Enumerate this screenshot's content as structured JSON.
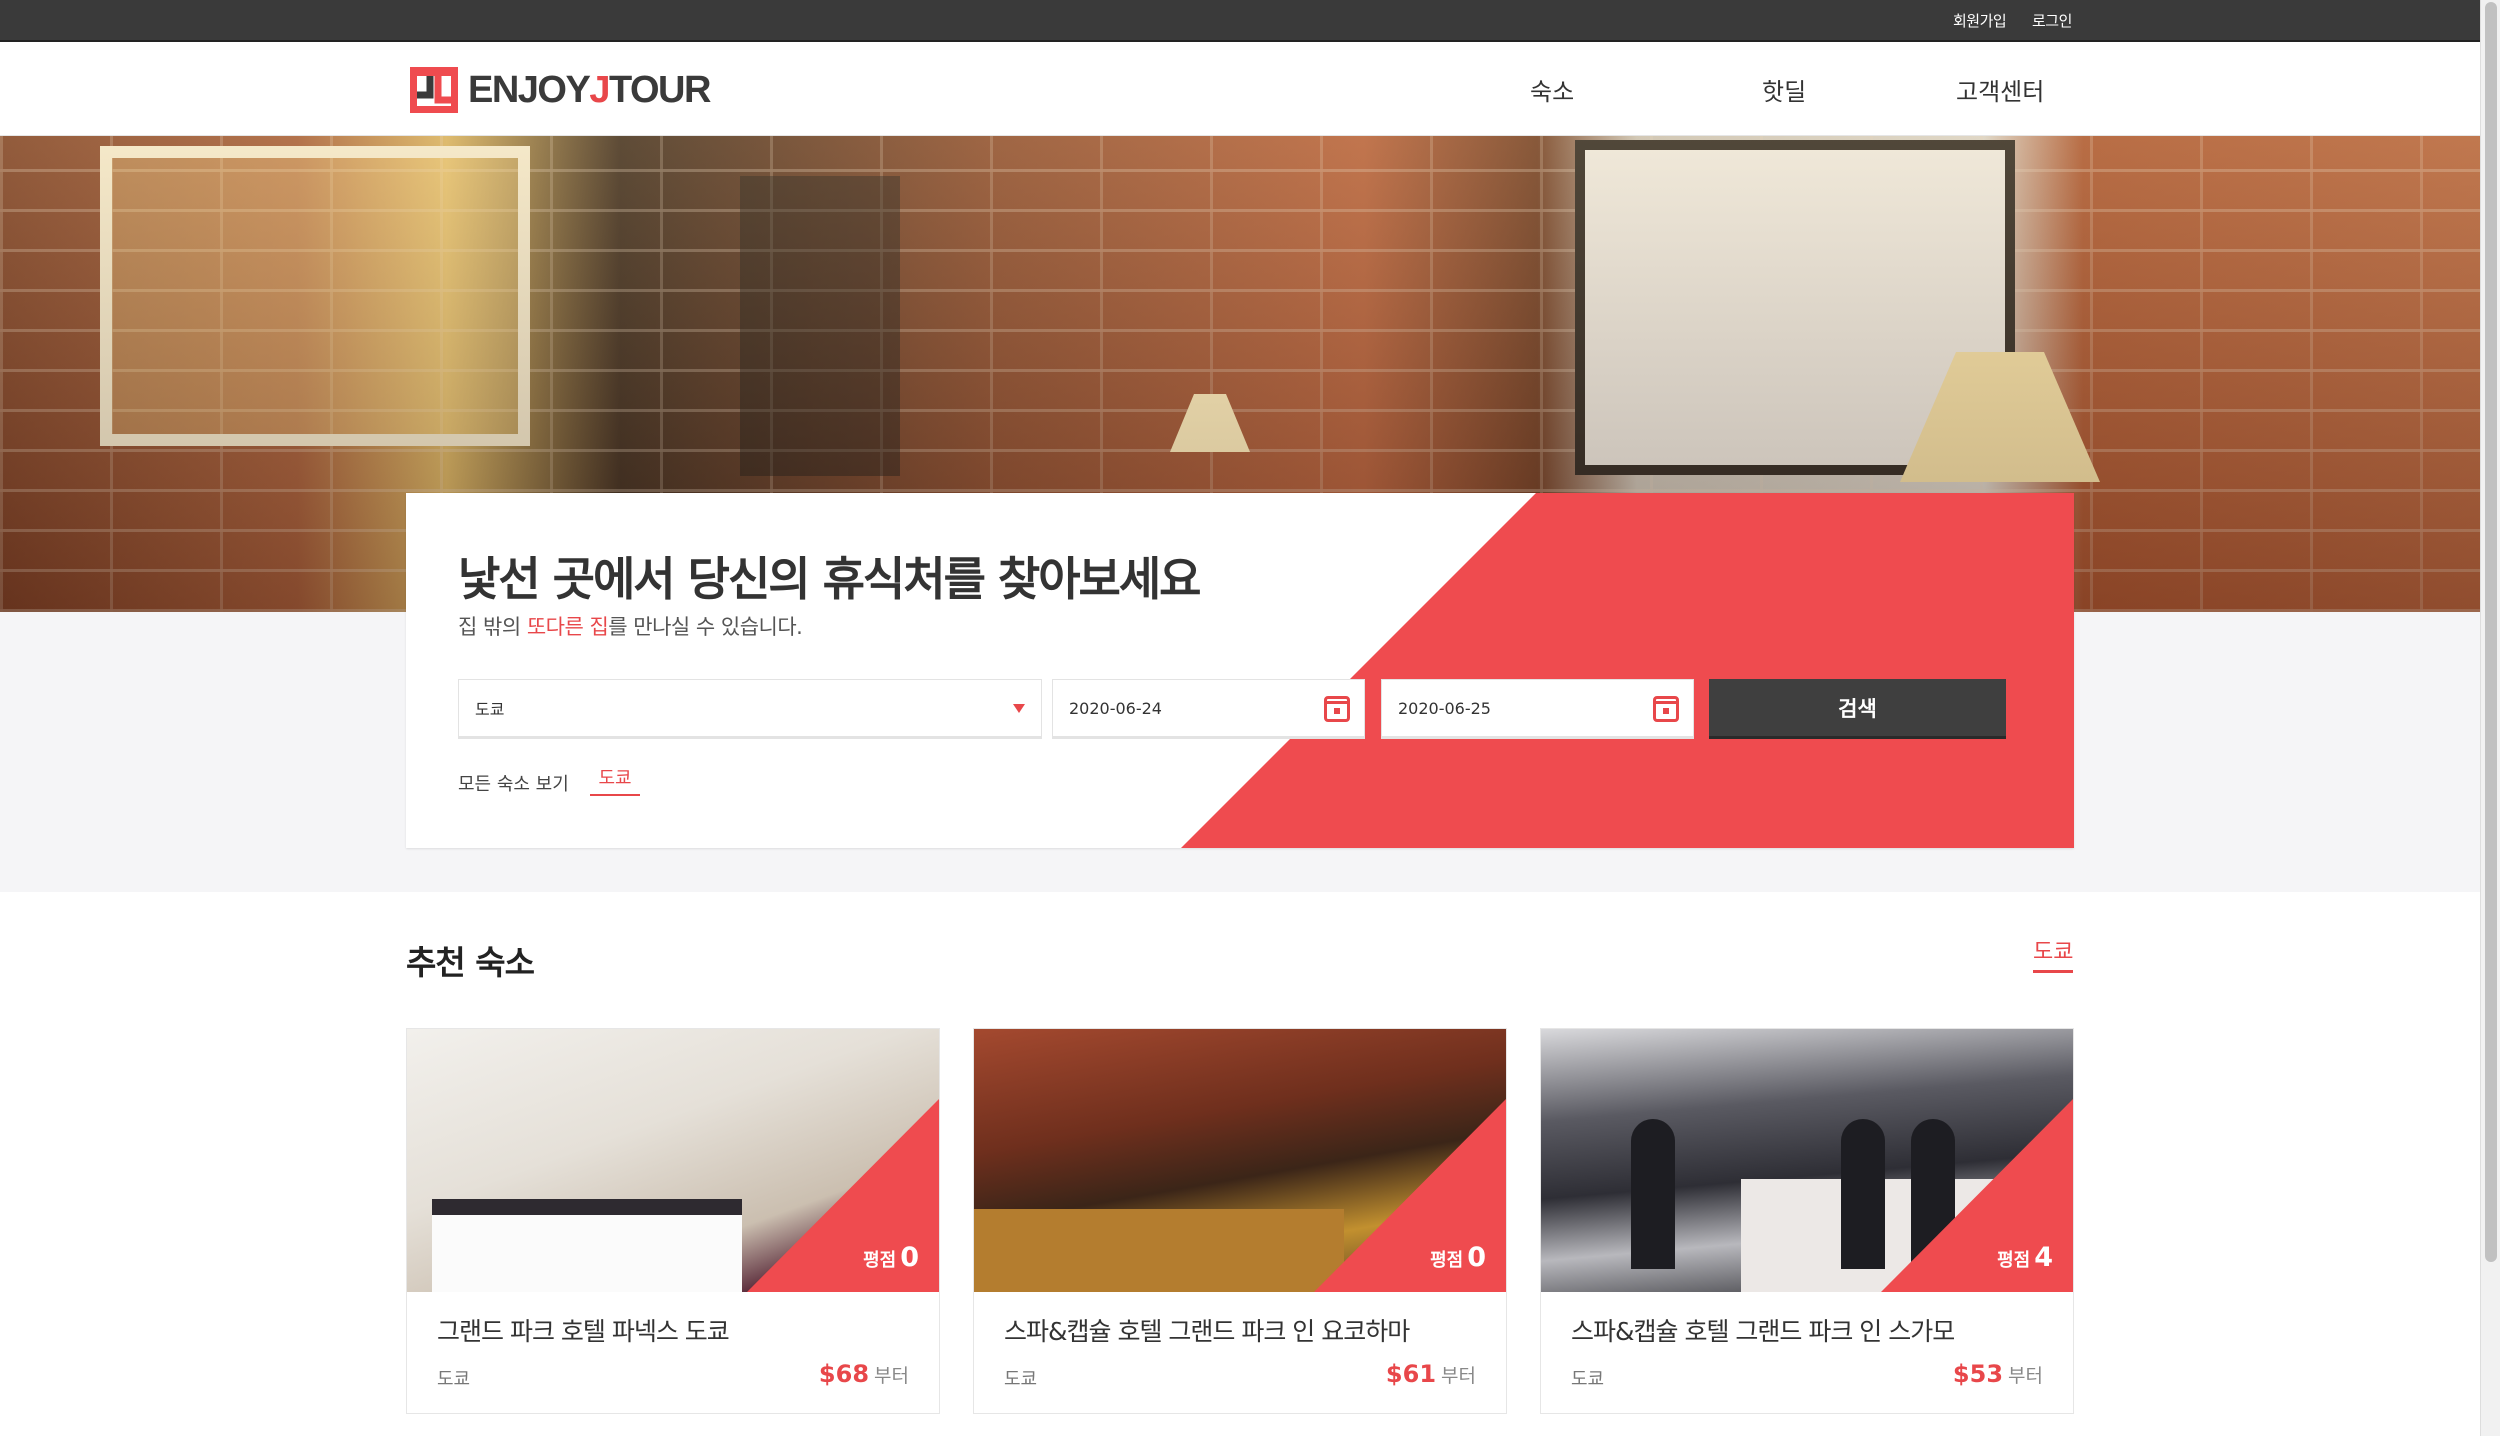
{
  "topbar": {
    "signup": "회원가입",
    "login": "로그인"
  },
  "logo": {
    "text_pre": "ENJOY",
    "text_j": "J",
    "text_post": "TOUR"
  },
  "nav": [
    "숙소",
    "핫딜",
    "고객센터"
  ],
  "hero": {
    "title": "낯선 곳에서 당신의 휴식처를 찾아보세요",
    "sub_pre": "집 밖의 ",
    "sub_highlight": "또다른 집",
    "sub_post": "를 만나실 수 있습니다."
  },
  "search": {
    "city": "도쿄",
    "checkin": "2020-06-24",
    "checkout": "2020-06-25",
    "button": "검색",
    "all_stays_label": "모든 숙소 보기",
    "all_stays_city": "도쿄"
  },
  "recommended": {
    "title": "추천 숙소",
    "city_link": "도쿄",
    "cards": [
      {
        "name": "그랜드 파크 호텔 파넥스 도쿄",
        "location": "도쿄",
        "rating_label": "평점",
        "rating": "0",
        "price": "$68",
        "price_suffix": "부터"
      },
      {
        "name": "스파&캡슐 호텔 그랜드 파크 인 요코하마",
        "location": "도쿄",
        "rating_label": "평점",
        "rating": "0",
        "price": "$61",
        "price_suffix": "부터"
      },
      {
        "name": "스파&캡슐 호텔 그랜드 파크 인 스가모",
        "location": "도쿄",
        "rating_label": "평점",
        "rating": "4",
        "price": "$53",
        "price_suffix": "부터"
      }
    ]
  },
  "colors": {
    "accent": "#ef4b4f",
    "dark": "#3a3a3a"
  }
}
